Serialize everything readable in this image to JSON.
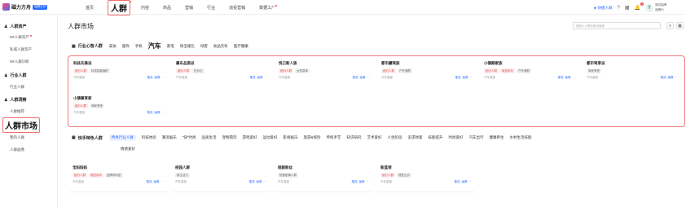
{
  "brand": {
    "name": "磁力方舟",
    "badge": "品牌方舟"
  },
  "topnav": [
    {
      "label": "首页"
    },
    {
      "label": "人群",
      "active": true
    },
    {
      "label": "内容"
    },
    {
      "label": "商品"
    },
    {
      "label": "营销"
    },
    {
      "label": "行业"
    },
    {
      "label": "追投营销"
    },
    {
      "label": "数据工厂"
    }
  ],
  "topright": {
    "quick_link": "快捷人群",
    "notify_count": "1",
    "user_name": "测试品牌",
    "user_sub": "品牌ID"
  },
  "sidebar": {
    "groups": [
      {
        "label": "人群资产"
      },
      {
        "label": "行业人群"
      },
      {
        "label": "人群洞察"
      }
    ],
    "items": [
      {
        "label": "5R人群资产"
      },
      {
        "label": "私域人群资产"
      },
      {
        "label": "5R人群诊断"
      },
      {
        "label": "行业人群"
      },
      {
        "label": "人群推荐"
      },
      {
        "label": "人群市场"
      },
      {
        "label": "我的人群"
      },
      {
        "label": "人群画像"
      }
    ]
  },
  "main": {
    "title": "人群市场",
    "search_placeholder": "搜索人人群关键词搜索",
    "section1": {
      "title": "行业心智人群",
      "tabs": [
        "美妆",
        "服饰",
        "手机",
        "汽车",
        "家电",
        "珠宝箱包",
        "母婴",
        "食品饮料",
        "医疗健康"
      ]
    },
    "cards1": [
      {
        "name": "科技先锋派",
        "tags": [
          "细分人群",
          "科技智能偏好"
        ],
        "meta": "汽车重度"
      },
      {
        "name": "豪车品质派",
        "tags": [
          "细分人群",
          "性价比"
        ],
        "meta": "汽车重度"
      },
      {
        "name": "悦己新人族",
        "tags": [
          "细分人群",
          "女性群体"
        ],
        "meta": "汽车重度"
      },
      {
        "name": "都市藏驾族",
        "tags": [
          "细分人群",
          "户外通勤"
        ],
        "meta": "汽车重度"
      },
      {
        "name": "小镇顾家族",
        "tags": [
          "细分人群",
          "家庭用车",
          "户外通勤"
        ],
        "meta": "汽车重度"
      },
      {
        "name": "都市驾享派",
        "tags": [
          "驾驶享受"
        ],
        "meta": "汽车重度"
      },
      {
        "name": "小镇尊享家",
        "tags": [
          "细分人群",
          "驾驶享受"
        ],
        "meta": "汽车重度"
      }
    ],
    "section2": {
      "title": "快手特色人群",
      "tabs": [
        "特色行业人群",
        "科技体验",
        "潮流娱乐",
        "\"快\"时尚",
        "品质生活",
        "宠物萌玩",
        "游戏爱好",
        "运动爱好",
        "影视娱乐",
        "旅游&探险",
        "传统手艺",
        "知识研究",
        "艺术爱好",
        "人生阶段",
        "追求财富",
        "技能提升",
        "时尚爱好",
        "汽车出行",
        "健康养生",
        "乡村生活技能",
        "情感爱好"
      ]
    },
    "cards2": [
      {
        "name": "宝妈妈妈",
        "tags": [
          "细分人群",
          "家庭用车",
          "品牌导向型"
        ],
        "meta": "汽车重度"
      },
      {
        "name": "校园人群",
        "tags": [
          "新生活力"
        ],
        "meta": "汽车重度"
      },
      {
        "name": "短剧粉丝",
        "tags": [
          "短剧剧情人群"
        ],
        "meta": "汽车重度"
      },
      {
        "name": "新蓝领",
        "tags": [
          "细分人群",
          "理性比价"
        ],
        "meta": "汽车重度"
      }
    ],
    "actions": {
      "detail": "推送",
      "compare": "画像",
      "more": "···"
    }
  }
}
